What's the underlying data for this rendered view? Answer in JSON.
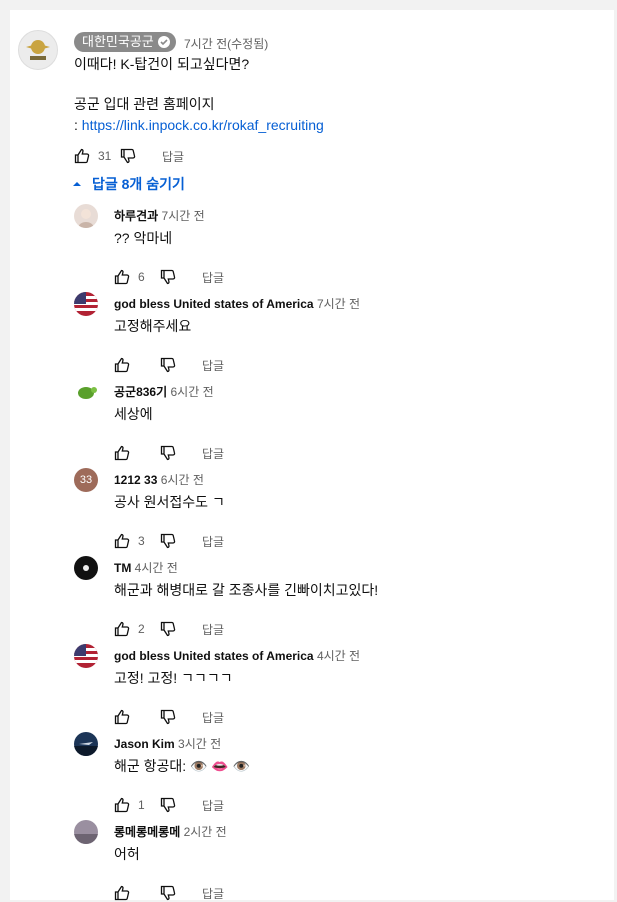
{
  "comment": {
    "author": "대한민국공군",
    "time": "7시간 전(수정됨)",
    "lines": [
      "이때다! K-탑건이 되고싶다면?",
      "공군 입대 관련 홈페이지"
    ],
    "link_prefix": ": ",
    "link_text": "https://link.inpock.co.kr/rokaf_recruiting",
    "likes": "31",
    "reply_label": "답글"
  },
  "replies_toggle": "답글 8개 숨기기",
  "replies": [
    {
      "author": "하루견과",
      "time": "7시간 전",
      "text": "?? 악마네",
      "likes": "6",
      "reply_label": "답글",
      "avatar": "photo"
    },
    {
      "author": "god bless United states of America",
      "time": "7시간 전",
      "text": "고정해주세요",
      "likes": "",
      "reply_label": "답글",
      "avatar": "flag"
    },
    {
      "author": "공군836기",
      "time": "6시간 전",
      "text": "세상에",
      "likes": "",
      "reply_label": "답글",
      "avatar": "turtle"
    },
    {
      "author": "1212 33",
      "time": "6시간 전",
      "text": "공사 원서접수도 ㄱ",
      "likes": "3",
      "reply_label": "답글",
      "avatar": "33"
    },
    {
      "author": "TM",
      "time": "4시간 전",
      "text": "해군과 해병대로 갈 조종사를 긴빠이치고있다!",
      "likes": "2",
      "reply_label": "답글",
      "avatar": "dark"
    },
    {
      "author": "god bless United states of America",
      "time": "4시간 전",
      "text": "고정! 고정! ㄱㄱㄱㄱ",
      "likes": "",
      "reply_label": "답글",
      "avatar": "flag"
    },
    {
      "author": "Jason Kim",
      "time": "3시간 전",
      "text": "해군 항공대: 👁️ 👄 👁️",
      "likes": "1",
      "reply_label": "답글",
      "avatar": "jet"
    },
    {
      "author": "롱메롱메롱메",
      "time": "2시간 전",
      "text": "어허",
      "likes": "",
      "reply_label": "답글",
      "avatar": "grey"
    }
  ],
  "colors": {
    "link": "#065fd4",
    "meta": "#606060",
    "chip": "#8a8a8a"
  }
}
